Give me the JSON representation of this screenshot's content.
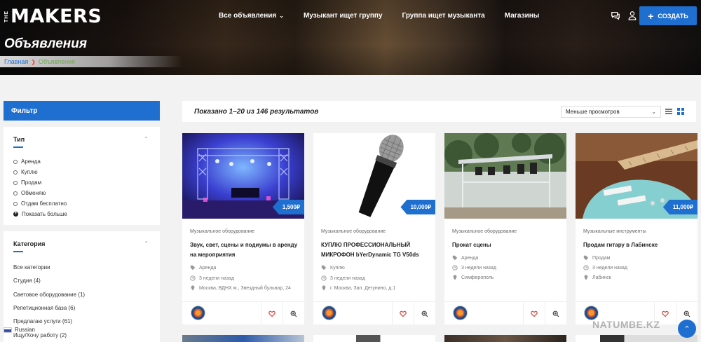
{
  "header": {
    "logo_small": "THE",
    "logo_main": "MAKERS",
    "nav": [
      "Все объявления",
      "Музыкант ищет группу",
      "Группа ищет музыканта",
      "Магазины"
    ],
    "create_label": "СОЗДАТЬ",
    "page_title": "Объявления",
    "breadcrumb_home": "Главная",
    "breadcrumb_current": "Объявления"
  },
  "sidebar": {
    "filter_title": "Фильтр",
    "type": {
      "title": "Тип",
      "items": [
        "Аренда",
        "Куплю",
        "Продам",
        "Обменяю",
        "Отдам бесплатно"
      ],
      "more": "Показать больше"
    },
    "category": {
      "title": "Категория",
      "items": [
        "Все категории",
        "Студия (4)",
        "Световое оборудование (1)",
        "Репетиционная база (6)",
        "Предлагаю услуги (61)",
        "Ищу/Хочу работу (2)"
      ]
    }
  },
  "results": {
    "count_text": "Показано 1–20 из 146 результатов",
    "sort_value": "Меньше просмотров"
  },
  "listings": [
    {
      "price": "1,500₽",
      "category": "Музыкальное оборудование",
      "title": "Звук, свет, сцены и подиумы в аренду на мероприятия",
      "type": "Аренда",
      "time": "3 недели назад",
      "location": "Москва, ВДНХ м., Звездный бульвар, 24"
    },
    {
      "price": "10,000₽",
      "category": "Музыкальное оборудование",
      "title": "КУПЛЮ ПРОФЕССИОНАЛЬНЫЙ МИКРОФОН bYerDynamic TG V50ds",
      "type": "Куплю",
      "time": "3 недели назад",
      "location": "г. Москва, Зап. Дегунино, д.1"
    },
    {
      "price": "",
      "category": "Музыкальное оборудование",
      "title": "Прокат сцены",
      "type": "Аренда",
      "time": "3 недели назад",
      "location": "Симферополь"
    },
    {
      "price": "11,000₽",
      "category": "Музыкальные инструменты",
      "title": "Продам гитару в Лабинске",
      "type": "Продам",
      "time": "3 недели назад",
      "location": "Лабинск"
    }
  ],
  "footer": {
    "language": "Russian",
    "watermark": "NATUMBE.KZ"
  },
  "colors": {
    "accent": "#1f6fd1",
    "breadcrumb_sep": "#e0433a"
  }
}
